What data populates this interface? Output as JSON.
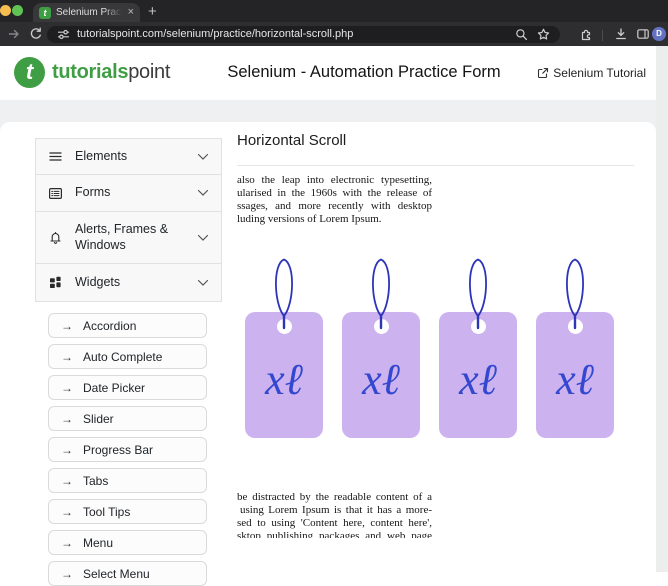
{
  "browser": {
    "traffic_lights": [
      "yellow",
      "green"
    ],
    "tab": {
      "title": "Selenium Practice - Horizonta",
      "close_icon": "×",
      "new_tab_icon": "+"
    },
    "toolbar": {
      "url": "tutorialspoint.com/selenium/practice/horizontal-scroll.php",
      "icons": [
        "forward-arrow",
        "reload",
        "site-settings",
        "zoom",
        "bookmark-star",
        "extensions",
        "download",
        "sidebar-panel"
      ],
      "avatar_letter": "D"
    }
  },
  "header": {
    "logo": {
      "mark": "t",
      "bold": "tutorials",
      "light": "point"
    },
    "title": "Selenium - Automation Practice Form",
    "tutorial_link": "Selenium Tutorial"
  },
  "sidebar": {
    "sections": [
      {
        "label": "Elements",
        "icon": "list-icon"
      },
      {
        "label": "Forms",
        "icon": "form-card-icon"
      },
      {
        "label": "Alerts, Frames & Windows",
        "icon": "bell-icon"
      },
      {
        "label": "Widgets",
        "icon": "widgets-grid-icon"
      }
    ],
    "item_arrow": "→",
    "items": [
      "Accordion",
      "Auto Complete",
      "Date Picker",
      "Slider",
      "Progress Bar",
      "Tabs",
      "Tool Tips",
      "Menu",
      "Select Menu"
    ]
  },
  "main": {
    "heading": "Horizontal Scroll",
    "paragraph_top": [
      "also the leap into electronic typesetting,",
      "ularised in the 1960s with the release of",
      "ssages, and more recently with desktop",
      "luding versions of Lorem Ipsum."
    ],
    "tag_label": "xℓ",
    "tag_count": 4,
    "paragraph_bottom": [
      "be distracted by the readable content of a",
      "using Lorem Ipsum is that it has a more-",
      "sed to using 'Content here, content here',",
      "sktop publishing packages and web page"
    ]
  },
  "colors": {
    "brand_green": "#3f9e43",
    "tag_fill": "#ccb3ef",
    "tag_string_blue": "#2d35b8",
    "tag_text_blue": "#3347cf",
    "avatar_blue": "#6472c4"
  }
}
